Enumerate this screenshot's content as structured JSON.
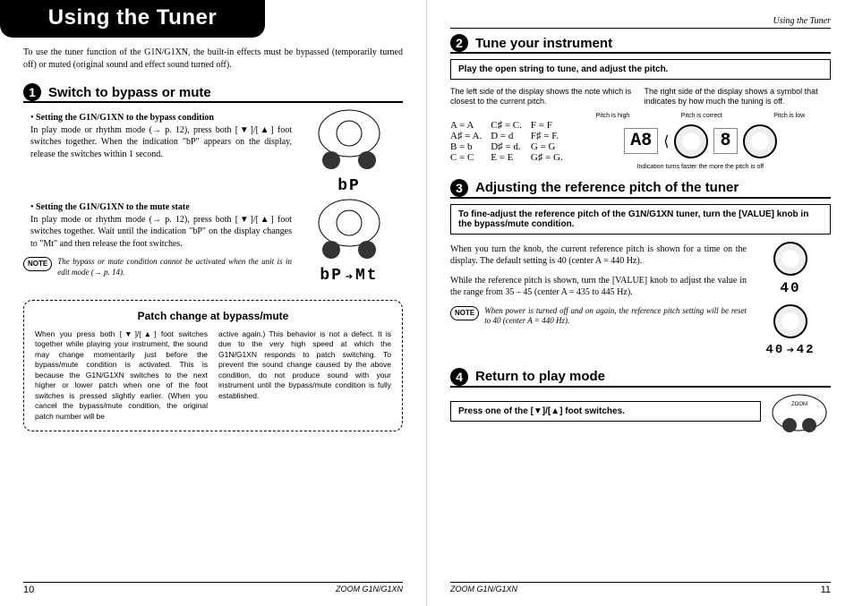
{
  "running_head": "Using the Tuner",
  "banner": "Using the Tuner",
  "intro": "To use the tuner function of the G1N/G1XN, the built-in effects must be bypassed (temporarily turned off) or muted (original sound and effect sound turned off).",
  "step1": {
    "num": "1",
    "title": "Switch to bypass or mute",
    "b1_head": "Setting the G1N/G1XN to the bypass condition",
    "b1_body": "In play mode or rhythm mode (→ p. 12), press both [▼]/[▲] foot switches together. When the indication \"bP\" appears on the display, release the switches within 1 second.",
    "b2_head": "Setting the G1N/G1XN to the mute state",
    "b2_body": "In play mode or rhythm mode (→ p. 12), press both [▼]/[▲] foot switches together. Wait until the indication \"bP\" on the display changes to \"Mt\" and then release the foot switches.",
    "note": "The bypass or mute condition cannot be activated when the unit is in edit mode (→ p. 14).",
    "seg1": "bP",
    "seg2a": "bP",
    "seg2b": "Mt"
  },
  "patchbox": {
    "title": "Patch change at bypass/mute",
    "col1": "When you press both [▼]/[▲] foot switches together while playing your instrument, the sound may change momentarily just before the bypass/mute condition is activated. This is because the G1N/G1XN switches to the next higher or lower patch when one of the foot switches is pressed slightly earlier. (When you cancel the bypass/mute condition, the original patch number will be",
    "col2": "active again.)\nThis behavior is not a defect. It is due to the very high speed at which the G1N/G1XN responds to patch switching. To prevent the sound change caused by the above condition, do not produce sound with your instrument until the bypass/mute condition is fully established."
  },
  "step2": {
    "num": "2",
    "title": "Tune your instrument",
    "inset": "Play the open string to tune, and adjust the pitch.",
    "left_caption": "The left side of the display shows the note which is closest to the current pitch.",
    "right_caption": "The right side of the display shows a symbol that indicates by how much the tuning is off.",
    "labels": {
      "high": "Pitch is high",
      "correct": "Pitch is correct",
      "low": "Pitch is low"
    },
    "indication": "Indication turns faster the more the pitch is off",
    "notes": [
      "A  = A",
      "C♯ = C.",
      "F  = F",
      "A♯ = A.",
      "D  = d",
      "F♯ = F.",
      "B  = b",
      "D♯ = d.",
      "G  = G",
      "C  = C",
      "E  = E",
      "G♯ = G."
    ],
    "seg_center": "A8"
  },
  "step3": {
    "num": "3",
    "title": "Adjusting the reference pitch of the tuner",
    "inset": "To fine-adjust the reference pitch of the G1N/G1XN tuner, turn the [VALUE] knob in the bypass/mute condition.",
    "p1": "When you turn the knob, the current reference pitch is shown for a time on the display. The default setting is 40 (center A = 440 Hz).",
    "p2": "While the reference pitch is shown, turn the [VALUE] knob to adjust the value in the range from 35 – 45 (center A = 435 to 445 Hz).",
    "note": "When power is turned off and on again, the reference pitch setting will be reset to 40 (center A = 440 Hz).",
    "seg_a": "40",
    "seg_b1": "40",
    "seg_b2": "42"
  },
  "step4": {
    "num": "4",
    "title": "Return to play mode",
    "inset": "Press one of the [▼]/[▲] foot switches."
  },
  "footer": {
    "model": "ZOOM G1N/G1XN",
    "left_page": "10",
    "right_page": "11"
  },
  "note_label": "NOTE"
}
